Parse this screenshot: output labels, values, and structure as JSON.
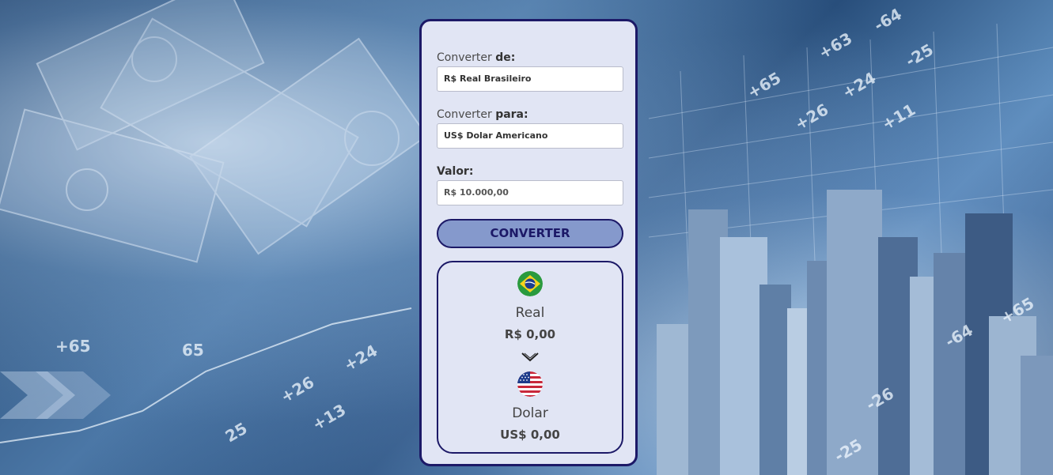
{
  "form": {
    "from_label_prefix": "Converter ",
    "from_label_bold": "de:",
    "from_value": "R$ Real Brasileiro",
    "to_label_prefix": "Converter ",
    "to_label_bold": "para:",
    "to_value": "US$ Dolar Americano",
    "amount_label": "Valor:",
    "amount_placeholder": "R$ 10.000,00",
    "convert_button": "CONVERTER"
  },
  "result": {
    "from": {
      "flag_icon": "brazil-flag-icon",
      "name": "Real",
      "value": "R$ 0,00"
    },
    "arrow_icon": "chevron-down-icon",
    "to": {
      "flag_icon": "usa-flag-icon",
      "name": "Dolar",
      "value": "US$ 0,00"
    }
  },
  "colors": {
    "accent": "#1c1967",
    "button_bg": "#8599cc",
    "card_bg": "#e1e5f4"
  }
}
